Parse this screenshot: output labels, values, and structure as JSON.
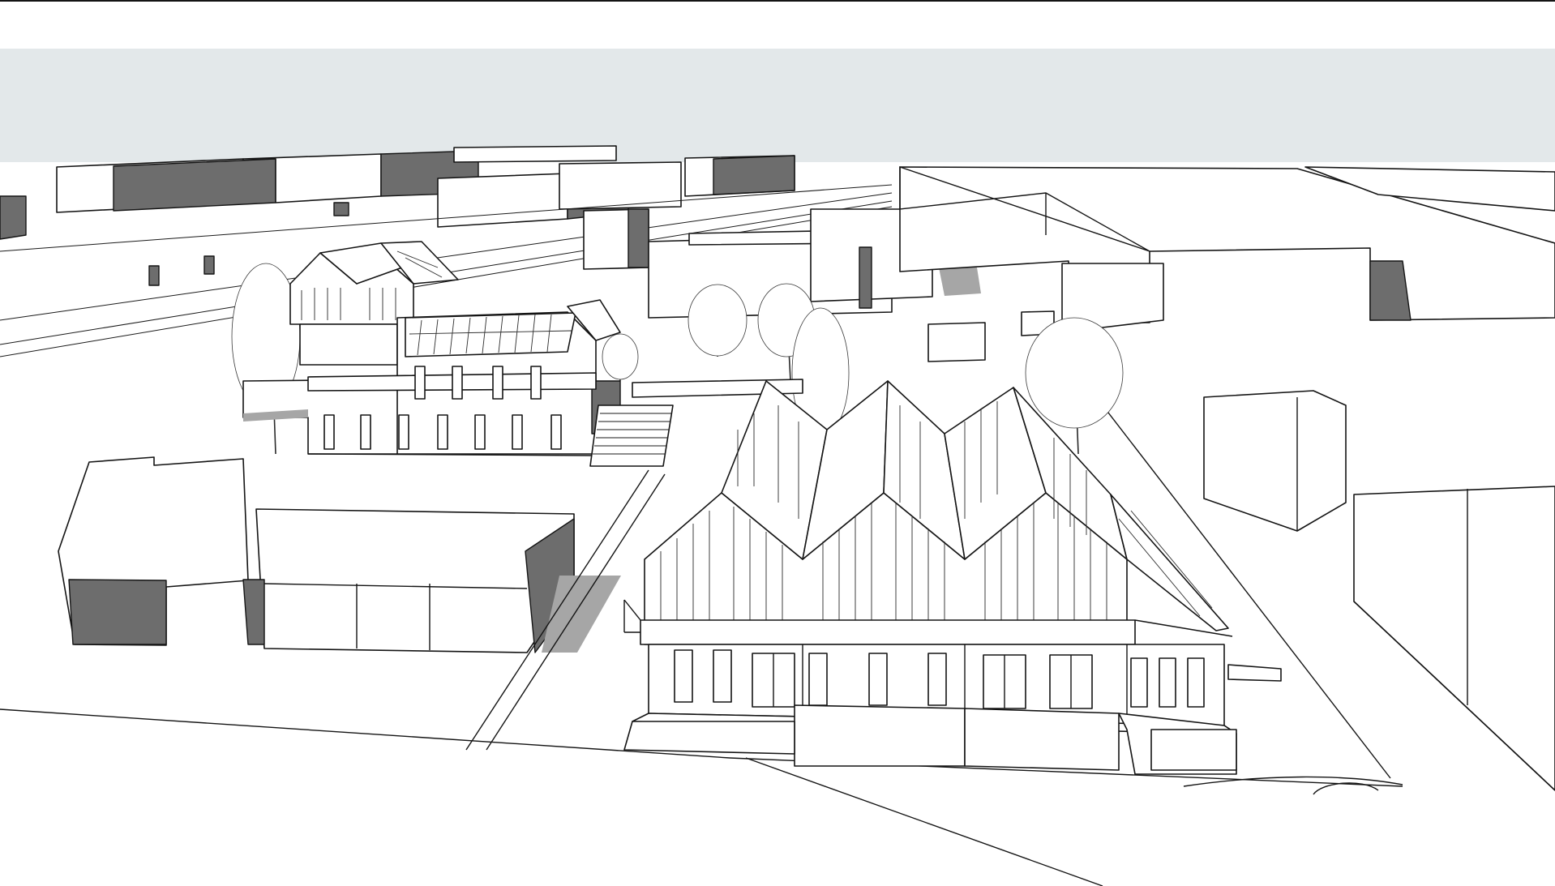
{
  "scene": {
    "kind": "3d-model-viewport",
    "render_style": "hidden-line with shadows",
    "background_color": "#ffffff",
    "sky_color": "#e3e8ea",
    "shadow_color": "#6d6d6d",
    "line_color": "#141414"
  }
}
